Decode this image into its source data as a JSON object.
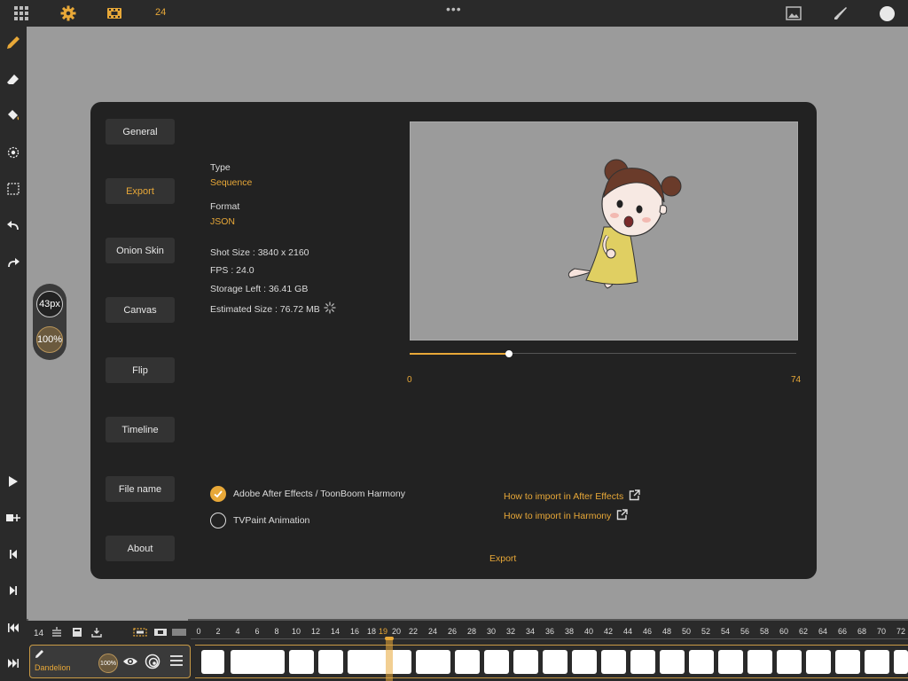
{
  "topbar": {
    "frame_count": "24",
    "more_glyph": "•••"
  },
  "brush": {
    "size": "43px",
    "opacity": "100%"
  },
  "dialog": {
    "nav": [
      "General",
      "Export",
      "Onion Skin",
      "Canvas",
      "Flip",
      "Timeline",
      "File name",
      "About"
    ],
    "active_nav": "Export",
    "type_label": "Type",
    "type_value": "Sequence",
    "format_label": "Format",
    "format_value": "JSON",
    "shot_size": "Shot Size :  3840 x 2160",
    "fps": "FPS :  24.0",
    "storage_left": "Storage Left : 36.41 GB",
    "estimated_size": "Estimated Size : 76.72 MB",
    "slider": {
      "min": "0",
      "max": "74",
      "current_frame": 19
    },
    "options": [
      {
        "label": "Adobe After Effects / ToonBoom Harmony",
        "checked": true
      },
      {
        "label": "TVPaint Animation",
        "checked": false
      }
    ],
    "links": [
      "How to import in After Effects",
      "How to import in Harmony"
    ],
    "export_label": "Export"
  },
  "timeline": {
    "current_frame_label": "14",
    "ruler": [
      "0",
      "2",
      "4",
      "6",
      "8",
      "10",
      "12",
      "14",
      "16",
      "18",
      "19",
      "20",
      "22",
      "24",
      "26",
      "28",
      "30",
      "32",
      "34",
      "36",
      "38",
      "40",
      "42",
      "44",
      "46",
      "48",
      "50",
      "52",
      "54",
      "56",
      "58",
      "60",
      "62",
      "64",
      "66",
      "68",
      "70",
      "72"
    ],
    "current_ruler_frame": "19",
    "layer_name": "Dandelion",
    "layer_opacity": "100%"
  },
  "colors": {
    "accent": "#e8a838",
    "bar_bg": "#2a2a2a",
    "dialog_bg": "#222222",
    "canvas_bg": "#9b9b9b"
  }
}
